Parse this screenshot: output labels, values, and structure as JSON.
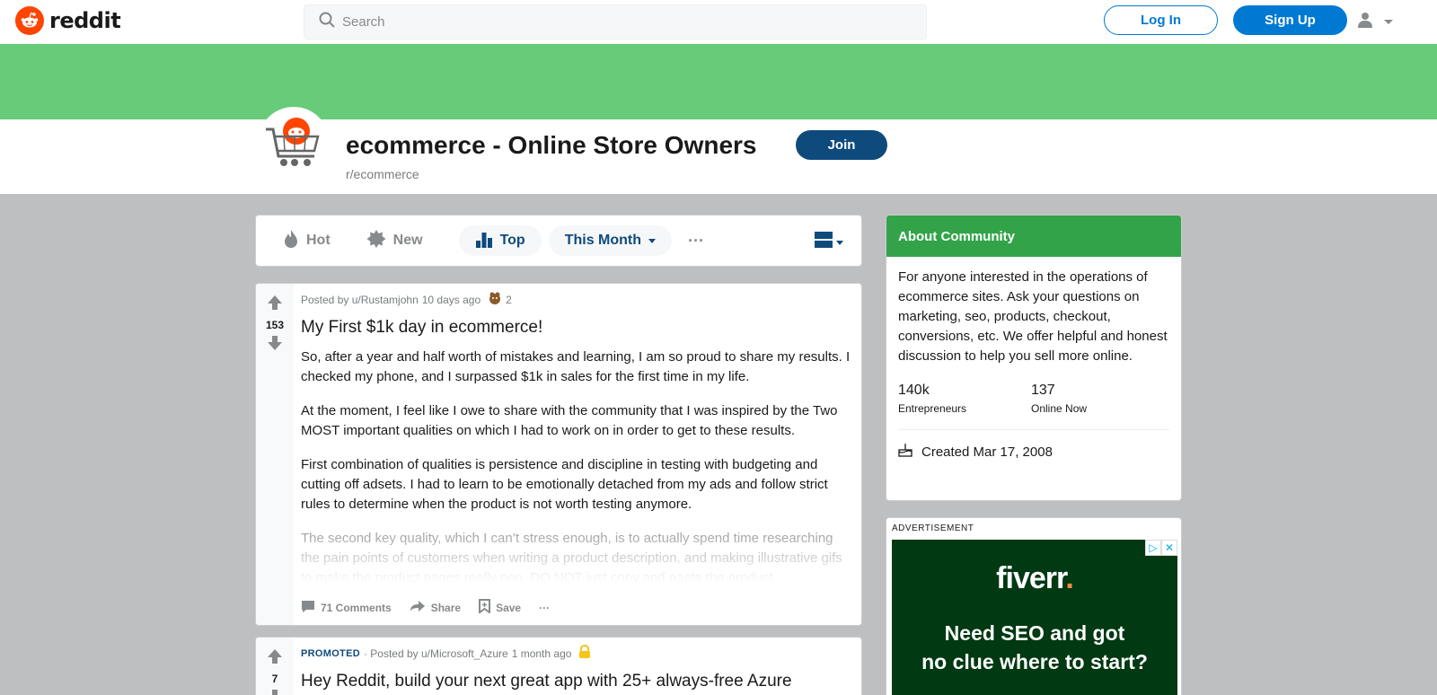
{
  "header": {
    "logo_text": "reddit",
    "search_placeholder": "Search",
    "login_label": "Log In",
    "signup_label": "Sign Up"
  },
  "subreddit": {
    "title": "ecommerce - Online Store Owners",
    "name": "r/ecommerce",
    "join_label": "Join",
    "banner_color": "#67cb7a"
  },
  "sort": {
    "hot": "Hot",
    "new": "New",
    "top": "Top",
    "period": "This Month",
    "more": "···"
  },
  "posts": [
    {
      "meta_posted_by": "Posted by u/Rustamjohn",
      "time": "10 days ago",
      "award_count": "2",
      "votes": "153",
      "title": "My First $1k day in ecommerce!",
      "paragraphs": [
        "So, after a year and half worth of mistakes and learning, I am so proud to share my results. I checked my phone, and I surpassed $1k in sales for the first time in my life.",
        "At the moment, I feel like I owe to share with the community that I was inspired by the Two MOST important qualities on which I had to work on in order to get to these results.",
        "First combination of qualities is persistence and discipline in testing with budgeting and cutting off adsets. I had to learn to be emotionally detached from my ads and follow strict rules to determine when the product is not worth testing anymore.",
        "The second key quality, which I can’t stress enough, is to actually spend time researching the pain points of customers when writing a product description, and making illustrative gifs to make the product pages really pop. DO NOT just copy and paste the product"
      ],
      "comments": "71 Comments",
      "share": "Share",
      "save": "Save",
      "more": "···"
    },
    {
      "promoted": "PROMOTED",
      "meta_posted_by": "· Posted by u/Microsoft_Azure",
      "time": "1 month ago",
      "votes": "7",
      "title": "Hey Reddit, build your next great app with 25+ always-free Azure"
    }
  ],
  "about": {
    "heading": "About Community",
    "description": "For anyone interested in the operations of ecommerce sites. Ask your questions on marketing, seo, products, checkout, conversions, etc. We offer helpful and honest discussion to help you sell more online.",
    "members": "140k",
    "members_label": "Entrepreneurs",
    "online": "137",
    "online_label": "Online Now",
    "created": "Created Mar 17, 2008",
    "header_color": "#33a34a"
  },
  "ad": {
    "label": "ADVERTISEMENT",
    "brand": "fiverr",
    "brand_dot": ".",
    "line1": "Need SEO and got",
    "line2": "no clue where to start?",
    "bg_color": "#013912"
  }
}
